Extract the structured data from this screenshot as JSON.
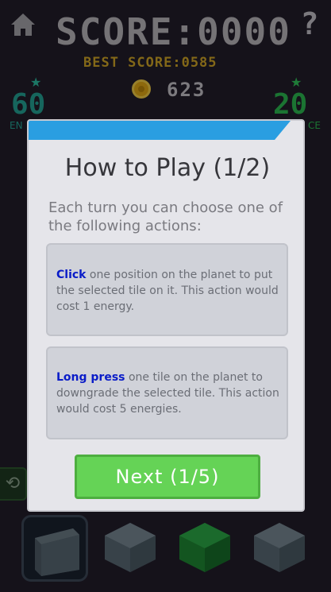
{
  "hud": {
    "home_icon": "home-icon",
    "help_icon": "question-mark-icon",
    "help_glyph": "?",
    "score": "SCORE:0000",
    "best_score": "BEST SCORE:0585",
    "coins": "623",
    "energy_value": "60",
    "energy_label": "EN",
    "space_value": "20",
    "space_label": "CE",
    "undo_icon": "undo-icon",
    "undo_glyph": "⟲"
  },
  "dialog": {
    "title": "How to Play (1/2)",
    "intro": "Each turn you can choose one of the following actions:",
    "actions": [
      {
        "keyword": "Click",
        "text": " one position on the planet to put the selected tile on it. This action would cost 1 energy."
      },
      {
        "keyword": "Long press",
        "text": " one tile on the planet to downgrade the selected tile. This action would cost 5 energies."
      }
    ],
    "next_label": "Next (1/5)"
  },
  "tiles": [
    {
      "name": "gray-cube",
      "color": "#52606b",
      "selected": true
    },
    {
      "name": "gray-cube",
      "color": "#5b6b76",
      "selected": false
    },
    {
      "name": "green-cube",
      "color": "#1f8a35",
      "selected": false
    },
    {
      "name": "gray-cube",
      "color": "#5b6b76",
      "selected": false
    }
  ],
  "colors": {
    "background": "#231d2b",
    "dialog_header": "#2a9ee1",
    "button_green": "#65d356",
    "keyword_blue": "#0a1cc8",
    "best_score_yellow": "#d3a827",
    "energy_teal": "#25a596",
    "space_green": "#2dbb52"
  }
}
